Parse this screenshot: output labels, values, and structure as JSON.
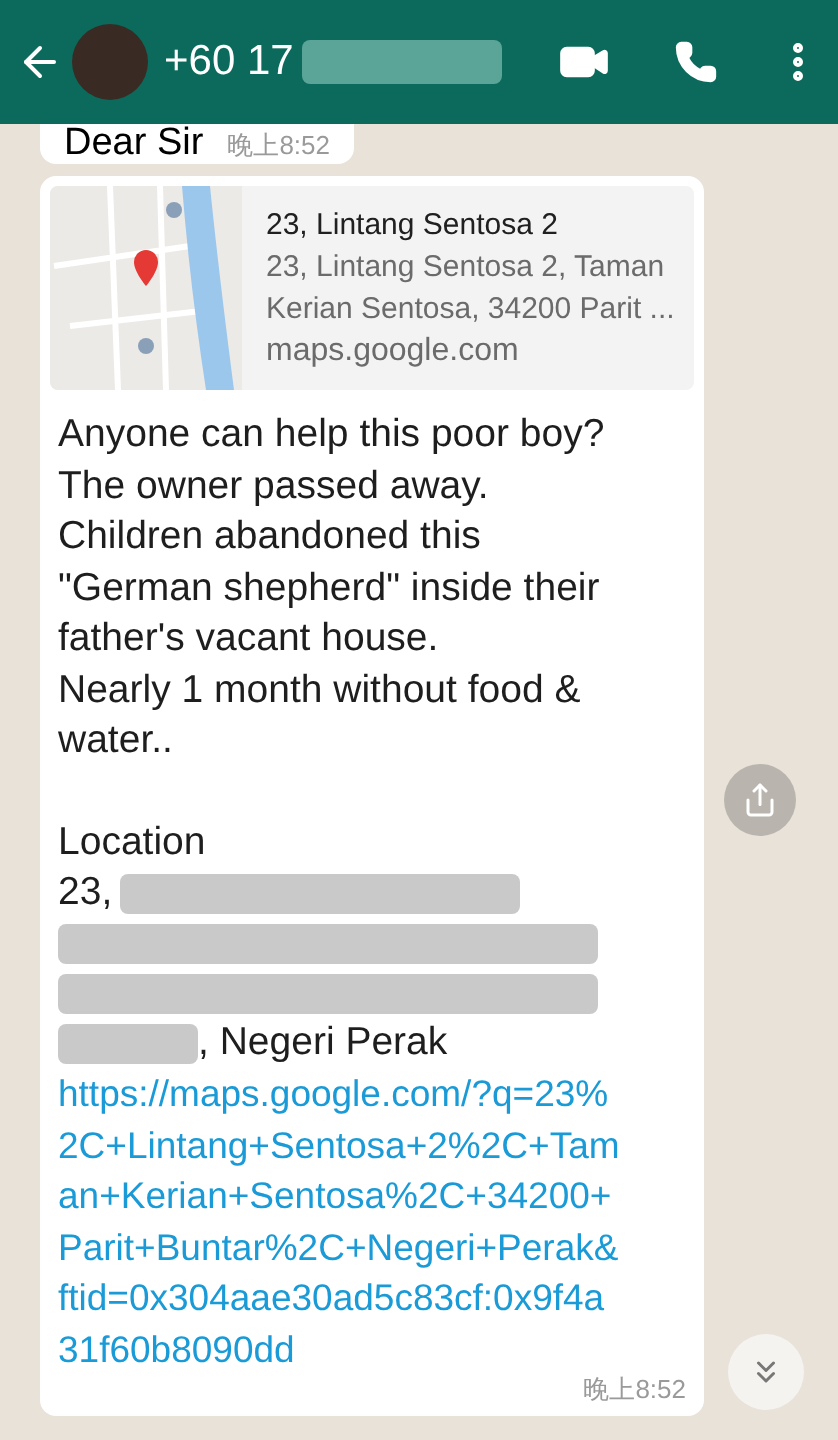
{
  "header": {
    "contact": "+60 17",
    "contact_redacted": true
  },
  "messages": [
    {
      "kind": "text",
      "text": "Dear Sir",
      "time": "晚上8:52"
    }
  ],
  "location_message": {
    "preview": {
      "kind": "picture",
      "title": "23, Lintang Sentosa 2",
      "description": "23, Lintang Sentosa 2, Taman Kerian Sentosa, 34200 Parit ...",
      "domain": "maps.google.com"
    },
    "body": "Anyone can help this poor boy?\nThe owner passed away.\nChildren abandoned this\n\"German shepherd\" inside their\nfather's vacant house.\nNearly 1 month without food &\nwater..",
    "location_heading": "Location",
    "address_lines": [
      {
        "kind": "text_then_redacted",
        "text": "23,"
      },
      {
        "kind": "redacted"
      },
      {
        "kind": "redacted"
      },
      {
        "kind": "redacted_then_text",
        "text": ", Negeri Perak"
      }
    ],
    "link": "https://maps.google.com/?q=23%2C+Lintang+Sentosa+2%2C+Taman+Kerian+Sentosa%2C+34200+Parit+Buntar%2C+Negeri+Perak&ftid=0x304aae30ad5c83cf:0x9f4a31f60b8090dd",
    "time": "晚上8:52"
  }
}
